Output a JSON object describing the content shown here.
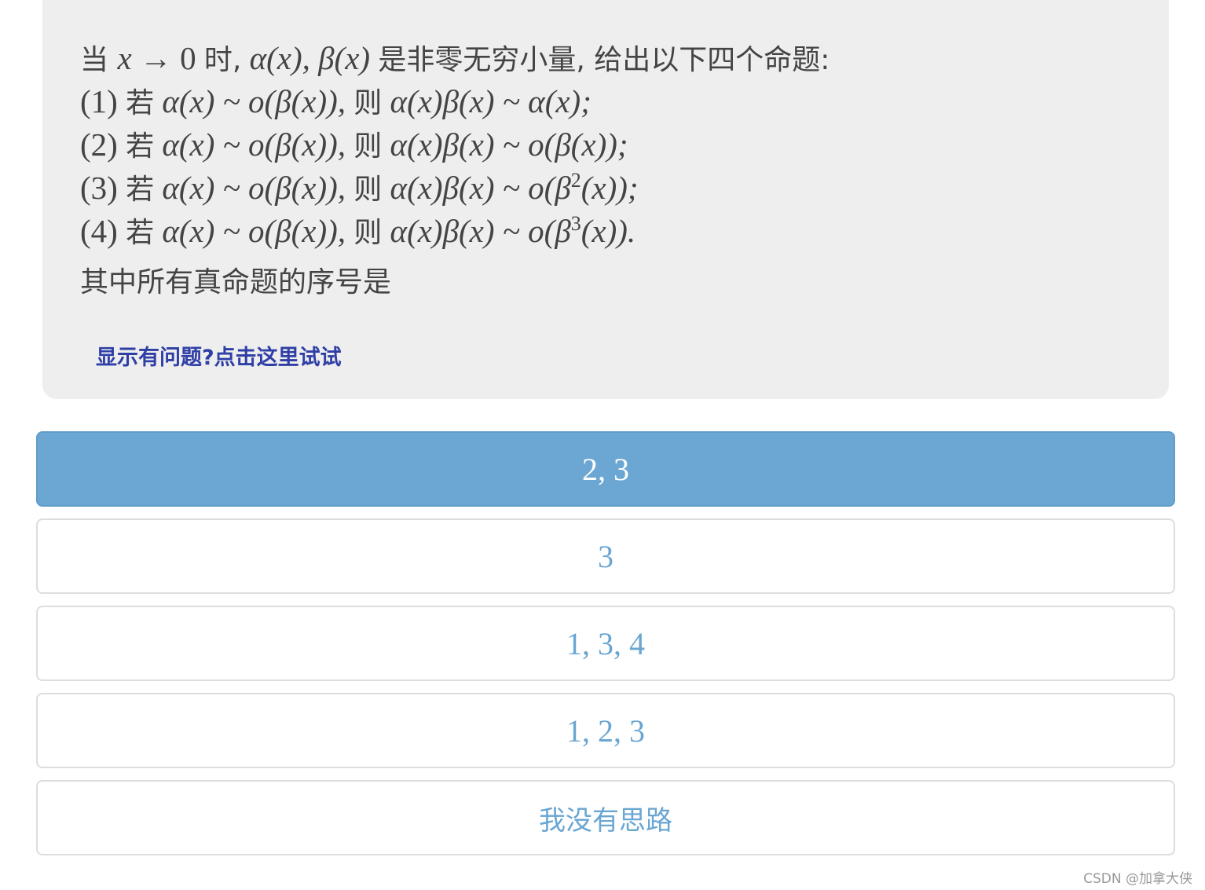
{
  "question": {
    "intro": {
      "prefix": "当 ",
      "var": "x",
      "arrow": " → 0 ",
      "shi": "时,",
      "alpha": " α(x), β(x) ",
      "rest": "是非零无穷小量, 给出以下四个命题:"
    },
    "statements": [
      {
        "num": "(1) ",
        "ruo": "若",
        "cond": " α(x) ~ o(β(x)), ",
        "ze": "则",
        "concl": " α(x)β(x) ~ α(x);",
        "sup": "",
        "tail": ""
      },
      {
        "num": "(2) ",
        "ruo": "若",
        "cond": " α(x) ~ o(β(x)), ",
        "ze": "则",
        "concl": " α(x)β(x) ~ o(β(x));",
        "sup": "",
        "tail": ""
      },
      {
        "num": "(3) ",
        "ruo": "若",
        "cond": " α(x) ~ o(β(x)), ",
        "ze": "则",
        "concl": " α(x)β(x) ~ o(β",
        "sup": "2",
        "tail": "(x));"
      },
      {
        "num": "(4) ",
        "ruo": "若",
        "cond": " α(x) ~ o(β(x)), ",
        "ze": "则",
        "concl": " α(x)β(x) ~ o(β",
        "sup": "3",
        "tail": "(x))."
      }
    ],
    "prompt": "其中所有真命题的序号是",
    "help_link": "显示有问题?点击这里试试"
  },
  "options": [
    {
      "label": "2, 3",
      "selected": true
    },
    {
      "label": "3",
      "selected": false
    },
    {
      "label": "1, 3, 4",
      "selected": false
    },
    {
      "label": "1, 2, 3",
      "selected": false
    },
    {
      "label": "我没有思路",
      "selected": false
    }
  ],
  "watermark": "CSDN @加拿大侠",
  "colors": {
    "card_bg": "#eeeeee",
    "selected_bg": "#6ca7d3",
    "option_text": "#6aa6d2",
    "link": "#2f3fa6"
  }
}
